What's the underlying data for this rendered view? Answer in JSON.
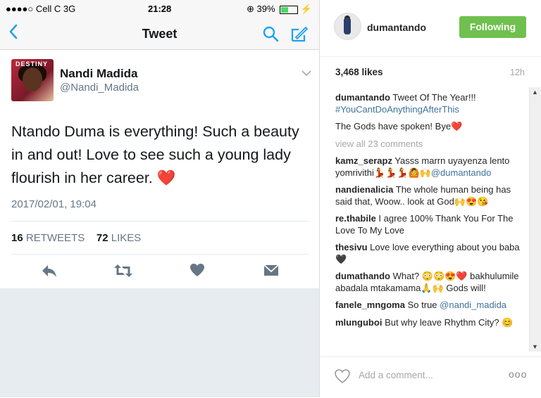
{
  "status_bar": {
    "carrier": "●●●●○ Cell C  3G ",
    "time": "21:28",
    "battery_text": "39%",
    "battery_level": 0.39
  },
  "tweet_nav": {
    "title": "Tweet",
    "icons": [
      "back-chevron-icon",
      "search-icon",
      "compose-icon"
    ]
  },
  "tweet": {
    "author_name": "Nandi Madida",
    "author_handle": "@Nandi_Madida",
    "text": "Ntando Duma is everything! Such a beauty in and out! Love to see such a young lady flourish in her career. ❤️",
    "date": "2017/02/01, 19:04",
    "retweets_count": "16",
    "retweets_label": "RETWEETS",
    "likes_count": "72",
    "likes_label": "LIKES",
    "actions": [
      "reply-icon",
      "retweet-icon",
      "like-heart-icon",
      "direct-message-icon"
    ],
    "accent": "#1da1f2"
  },
  "instagram": {
    "username": "dumantando",
    "follow_label": "Following",
    "follow_color": "#70c050",
    "likes": "3,468 likes",
    "time_ago": "12h",
    "caption_user": "dumantando",
    "caption_text": "Tweet Of The Year!!!",
    "caption_tag": "#YouCantDoAnythingAfterThis",
    "caption_line2": "The Gods have spoken! Bye❤️",
    "view_all": "view all 23 comments",
    "comments": [
      {
        "user": "kamz_serapz",
        "text": "Yasss marrn uyayenza lento yomrivithi💃💃💃🙆🙌",
        "mention": "@dumantando"
      },
      {
        "user": "nandienalicia",
        "text": "The whole human being has said that, Woow.. look at God🙌😍😘",
        "mention": ""
      },
      {
        "user": "re.thabile",
        "text": "I agree 100% Thank You For The Love To My Love",
        "mention": ""
      },
      {
        "user": "thesivu",
        "text": "Love love everything about you baba 🖤",
        "mention": ""
      },
      {
        "user": "dumathando",
        "text": "What? 😳😳😍❤️ bakhulumile abadala mtakamama🙏🙌 Gods will!",
        "mention": ""
      },
      {
        "user": "fanele_mngoma",
        "text": "So true",
        "mention": "@nandi_madida"
      },
      {
        "user": "mlunguboi",
        "text": "But why leave Rhythm City? 😊",
        "mention": ""
      }
    ],
    "add_comment_placeholder": "Add a comment...",
    "more_label": "ooo"
  }
}
